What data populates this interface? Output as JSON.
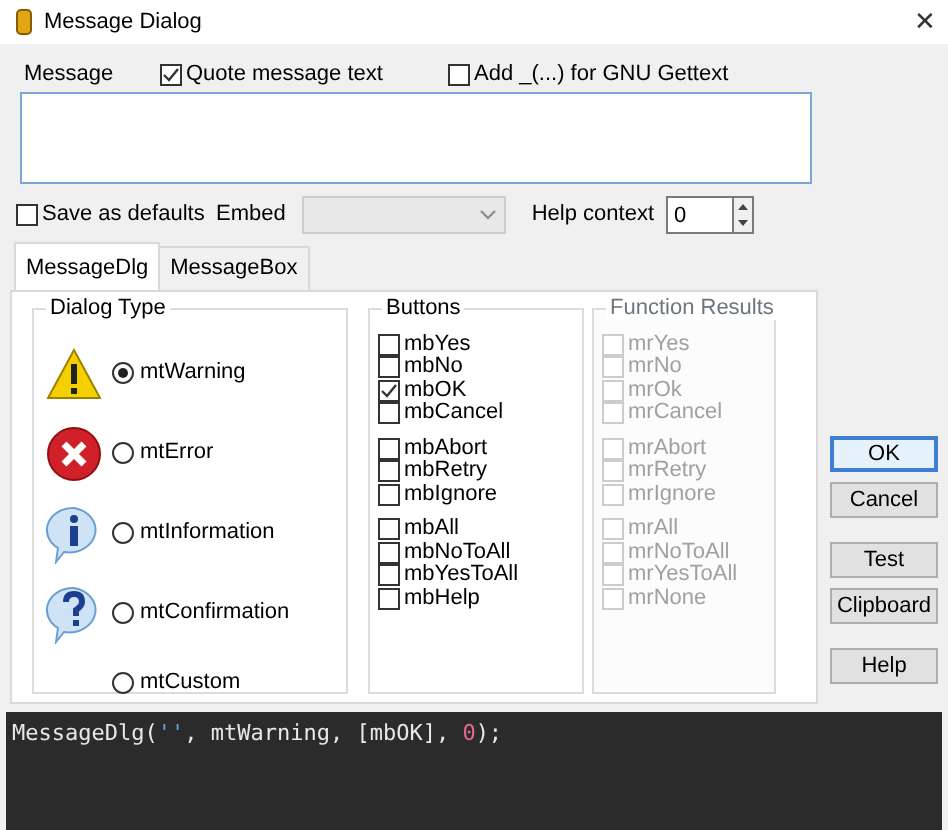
{
  "window": {
    "title": "Message Dialog",
    "close": "✕"
  },
  "message": {
    "label": "Message"
  },
  "quote": {
    "label": "Quote message text",
    "checked": true
  },
  "gettext": {
    "label": "Add _(...) for GNU Gettext",
    "checked": false
  },
  "save_defaults": {
    "label": "Save as defaults",
    "checked": false
  },
  "embed": {
    "label": "Embed",
    "disabled": true
  },
  "help_context": {
    "label": "Help context",
    "value": "0"
  },
  "tabs": [
    {
      "label": "MessageDlg",
      "selected": true
    },
    {
      "label": "MessageBox",
      "selected": false
    }
  ],
  "dialog_type": {
    "title": "Dialog Type",
    "items": [
      {
        "label": "mtWarning",
        "kind": "warning",
        "selected": true
      },
      {
        "label": "mtError",
        "kind": "error",
        "selected": false
      },
      {
        "label": "mtInformation",
        "kind": "information",
        "selected": false
      },
      {
        "label": "mtConfirmation",
        "kind": "confirmation",
        "selected": false
      },
      {
        "label": "mtCustom",
        "kind": "none",
        "selected": false
      }
    ]
  },
  "buttons": {
    "title": "Buttons",
    "disabled": false,
    "groups": [
      [
        {
          "label": "mbYes",
          "checked": false
        },
        {
          "label": "mbNo",
          "checked": false
        },
        {
          "label": "mbOK",
          "checked": true
        },
        {
          "label": "mbCancel",
          "checked": false
        }
      ],
      [
        {
          "label": "mbAbort",
          "checked": false
        },
        {
          "label": "mbRetry",
          "checked": false
        },
        {
          "label": "mbIgnore",
          "checked": false
        }
      ],
      [
        {
          "label": "mbAll",
          "checked": false
        },
        {
          "label": "mbNoToAll",
          "checked": false
        },
        {
          "label": "mbYesToAll",
          "checked": false
        },
        {
          "label": "mbHelp",
          "checked": false
        }
      ]
    ]
  },
  "function_results": {
    "title": "Function Results",
    "disabled": true,
    "groups": [
      [
        {
          "label": "mrYes",
          "checked": false
        },
        {
          "label": "mrNo",
          "checked": false
        },
        {
          "label": "mrOk",
          "checked": false
        },
        {
          "label": "mrCancel",
          "checked": false
        }
      ],
      [
        {
          "label": "mrAbort",
          "checked": false
        },
        {
          "label": "mrRetry",
          "checked": false
        },
        {
          "label": "mrIgnore",
          "checked": false
        }
      ],
      [
        {
          "label": "mrAll",
          "checked": false
        },
        {
          "label": "mrNoToAll",
          "checked": false
        },
        {
          "label": "mrYesToAll",
          "checked": false
        },
        {
          "label": "mrNone",
          "checked": false
        }
      ]
    ]
  },
  "action_groups": [
    [
      {
        "label": "OK",
        "default": true
      },
      {
        "label": "Cancel",
        "default": false
      }
    ],
    [
      {
        "label": "Test",
        "default": false
      },
      {
        "label": "Clipboard",
        "default": false
      }
    ],
    [
      {
        "label": "Help",
        "default": false
      }
    ]
  ],
  "code": [
    {
      "text": "MessageDlg(",
      "kind": "plain"
    },
    {
      "text": "''",
      "kind": "string"
    },
    {
      "text": ", mtWarning, [mbOK], ",
      "kind": "plain"
    },
    {
      "text": "0",
      "kind": "number"
    },
    {
      "text": ");",
      "kind": "plain"
    }
  ]
}
